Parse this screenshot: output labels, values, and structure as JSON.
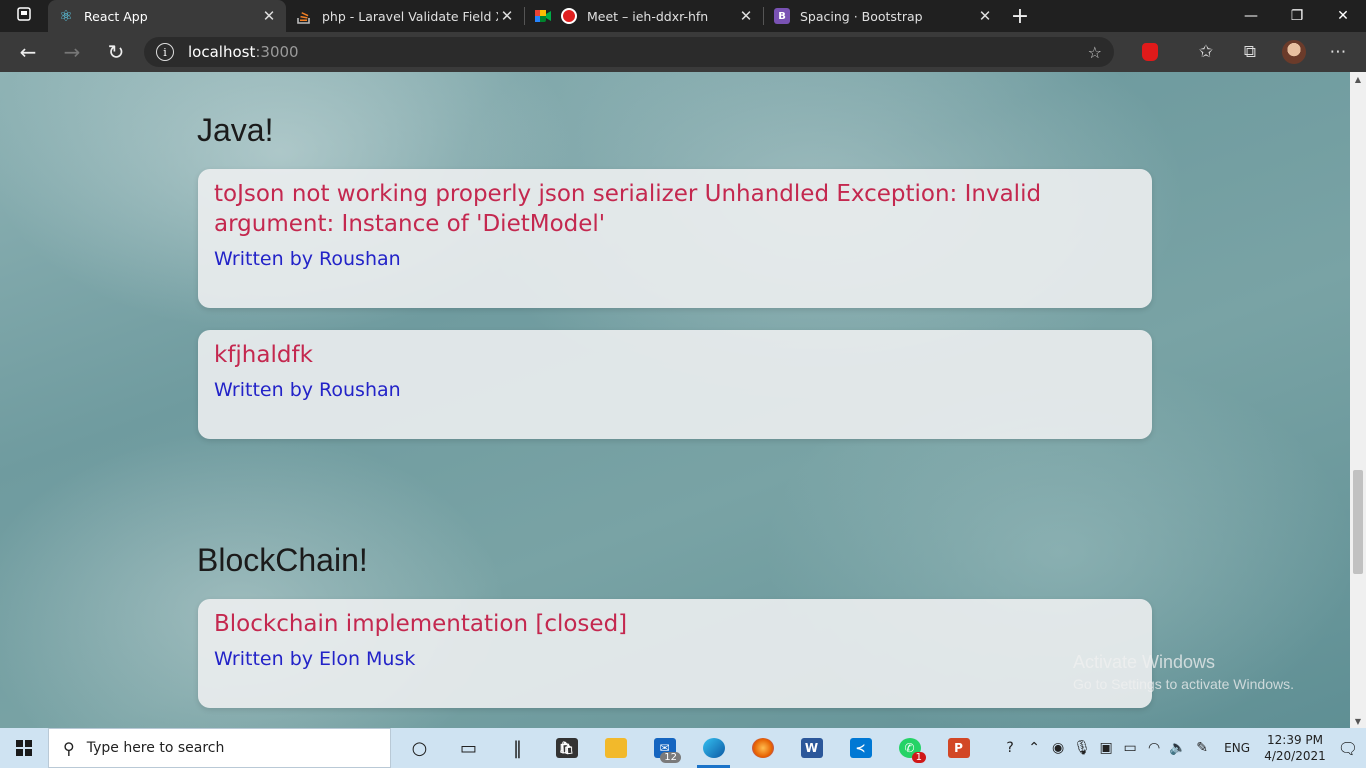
{
  "browser": {
    "tabs": [
      {
        "title": "React App",
        "favicon": "react-icon",
        "color": "#61dafb",
        "active": true
      },
      {
        "title": "php - Laravel Validate Field X if F",
        "favicon": "stackoverflow-icon",
        "color": "#f48024",
        "active": false
      },
      {
        "title": "Meet – ieh-ddxr-hfn",
        "favicon": "google-meet-icon",
        "color": "#00832d",
        "active": false
      },
      {
        "title": "Spacing · Bootstrap",
        "favicon": "bootstrap-icon",
        "color": "#7952b3",
        "active": false
      }
    ],
    "close_glyph": "✕",
    "new_tab_glyph": "+",
    "address_host": "localhost",
    "address_port": ":3000"
  },
  "page": {
    "sections": [
      {
        "heading": "Java!",
        "cards": [
          {
            "title": "toJson not working properly json serializer Unhandled Exception: Invalid argument: Instance of 'DietModel'",
            "author": "Written by Roushan"
          },
          {
            "title": "kfjhaldfk",
            "author": "Written by Roushan"
          }
        ]
      },
      {
        "heading": "BlockChain!",
        "cards": [
          {
            "title": "Blockchain implementation [closed]",
            "author": "Written by Elon Musk"
          }
        ]
      }
    ],
    "watermark_title": "Activate Windows",
    "watermark_sub": "Go to Settings to activate Windows."
  },
  "taskbar": {
    "search_placeholder": "Type here to search",
    "mail_badge": "12",
    "whatsapp_badge": "1",
    "language": "ENG",
    "time": "12:39 PM",
    "date": "4/20/2021"
  }
}
